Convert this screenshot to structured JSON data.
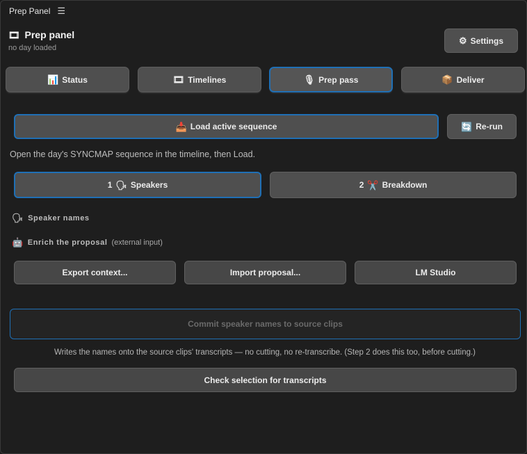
{
  "window": {
    "title": "Prep Panel",
    "menu_icon": "hamburger-icon"
  },
  "header": {
    "icon": "film-icon",
    "title": "Prep panel",
    "subtitle": "no day loaded",
    "settings_label": "Settings"
  },
  "tabs": [
    {
      "label": "Status",
      "icon": "chart-icon",
      "active": false
    },
    {
      "label": "Timelines",
      "icon": "film-frames-icon",
      "active": false
    },
    {
      "label": "Prep pass",
      "icon": "microphone-icon",
      "active": true
    },
    {
      "label": "Deliver",
      "icon": "package-icon",
      "active": false
    }
  ],
  "load": {
    "label": "Load active sequence",
    "rerun_label": "Re-run"
  },
  "hint": "Open the day's SYNCMAP sequence in the timeline, then Load.",
  "steps": [
    {
      "number": "1",
      "label": "Speakers",
      "active": true
    },
    {
      "number": "2",
      "label": "Breakdown",
      "active": false
    }
  ],
  "sections": {
    "speaker_names": "Speaker names",
    "enrich": "Enrich the proposal",
    "enrich_note": "(external input)"
  },
  "enrich_buttons": {
    "export": "Export context...",
    "import": "Import proposal...",
    "lmstudio": "LM Studio"
  },
  "commit_label": "Commit speaker names to source clips",
  "note": "Writes the names onto the source clips' transcripts — no cutting, no re-transcribe. (Step 2 does this too, before cutting.)",
  "check_label": "Check selection for transcripts",
  "colors": {
    "accent": "#1f6fb5",
    "background": "#1e1e1e",
    "button": "#4f4f4f"
  }
}
